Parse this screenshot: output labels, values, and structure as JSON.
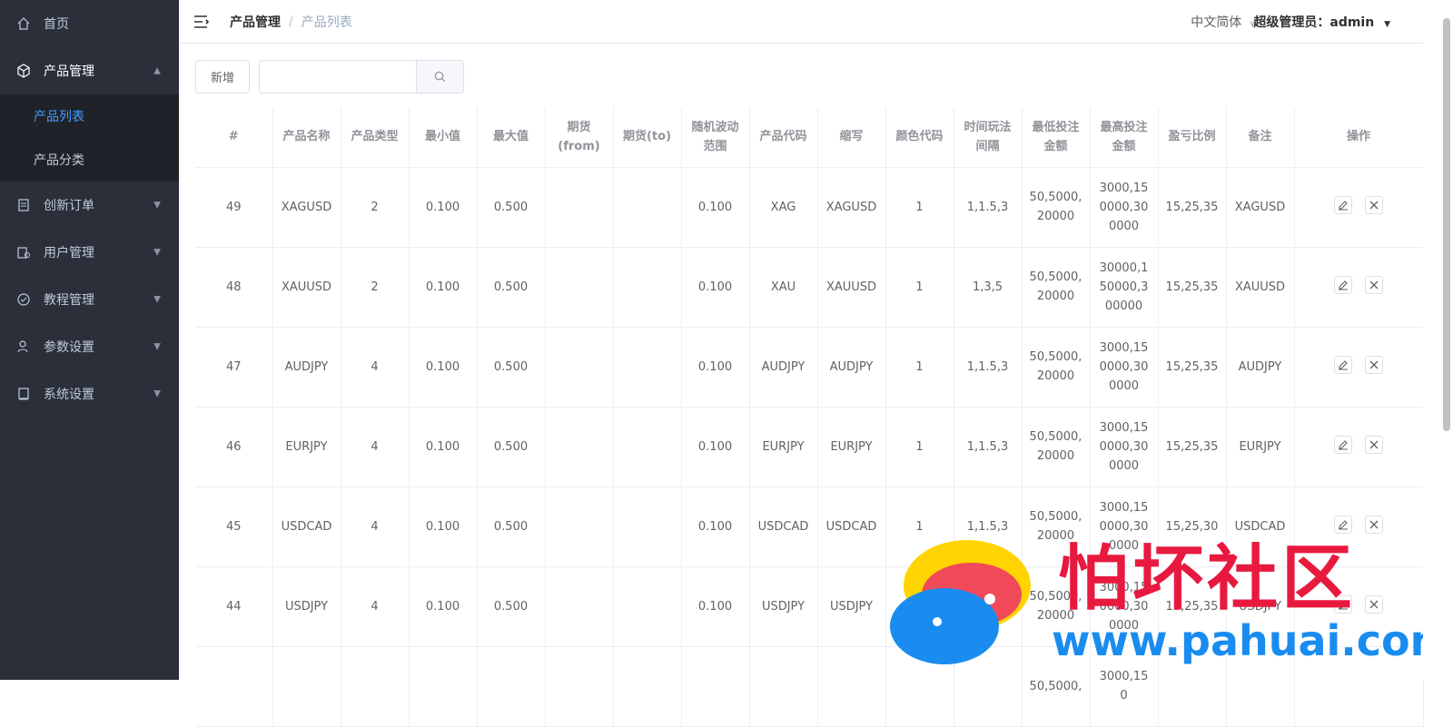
{
  "sidebar": {
    "items": [
      {
        "label": "首页",
        "icon": "home-icon"
      },
      {
        "label": "产品管理",
        "icon": "box-icon",
        "open": true,
        "children": [
          {
            "label": "产品列表",
            "active": true
          },
          {
            "label": "产品分类"
          }
        ]
      },
      {
        "label": "创新订单",
        "icon": "clipboard-icon"
      },
      {
        "label": "用户管理",
        "icon": "users-icon"
      },
      {
        "label": "教程管理",
        "icon": "check-circle-icon"
      },
      {
        "label": "参数设置",
        "icon": "user-settings-icon"
      },
      {
        "label": "系统设置",
        "icon": "book-icon"
      }
    ]
  },
  "header": {
    "breadcrumb": [
      "产品管理",
      "产品列表"
    ],
    "language": "中文简体",
    "user": "超级管理员：admin"
  },
  "toolbar": {
    "add_label": "新增",
    "search_placeholder": ""
  },
  "table": {
    "columns": [
      "#",
      "产品名称",
      "产品类型",
      "最小值",
      "最大值",
      "期货(from)",
      "期货(to)",
      "随机波动范围",
      "产品代码",
      "缩写",
      "颜色代码",
      "时间玩法间隔",
      "最低投注金额",
      "最高投注金额",
      "盈亏比例",
      "备注",
      "操作"
    ],
    "rows": [
      [
        "49",
        "XAGUSD",
        "2",
        "0.100",
        "0.500",
        "",
        "",
        "0.100",
        "XAG",
        "XAGUSD",
        "1",
        "1,1.5,3",
        "50,5000,20000",
        "3000,150000,300000",
        "15,25,35",
        "XAGUSD"
      ],
      [
        "48",
        "XAUUSD",
        "2",
        "0.100",
        "0.500",
        "",
        "",
        "0.100",
        "XAU",
        "XAUUSD",
        "1",
        "1,3,5",
        "50,5000,20000",
        "30000,150000,300000",
        "15,25,35",
        "XAUUSD"
      ],
      [
        "47",
        "AUDJPY",
        "4",
        "0.100",
        "0.500",
        "",
        "",
        "0.100",
        "AUDJPY",
        "AUDJPY",
        "1",
        "1,1.5,3",
        "50,5000,20000",
        "3000,150000,300000",
        "15,25,35",
        "AUDJPY"
      ],
      [
        "46",
        "EURJPY",
        "4",
        "0.100",
        "0.500",
        "",
        "",
        "0.100",
        "EURJPY",
        "EURJPY",
        "1",
        "1,1.5,3",
        "50,5000,20000",
        "3000,150000,300000",
        "15,25,35",
        "EURJPY"
      ],
      [
        "45",
        "USDCAD",
        "4",
        "0.100",
        "0.500",
        "",
        "",
        "0.100",
        "USDCAD",
        "USDCAD",
        "1",
        "1,1.5,3",
        "50,5000,20000",
        "3000,150000,300000",
        "15,25,30",
        "USDCAD"
      ],
      [
        "44",
        "USDJPY",
        "4",
        "0.100",
        "0.500",
        "",
        "",
        "0.100",
        "USDJPY",
        "USDJPY",
        "1",
        "1,1.5,3",
        "50,5000,20000",
        "3000,150000,300000",
        "15,25,35",
        "USDJPY"
      ],
      [
        "",
        "",
        "",
        "",
        "",
        "",
        "",
        "",
        "",
        "",
        "",
        "",
        "50,5000,",
        "3000,150",
        "",
        ""
      ]
    ]
  },
  "watermark": {
    "title": "怕坏社区",
    "url": "www.pahuai.com"
  },
  "colors": {
    "sidebar_bg": "#2b2f3a",
    "active": "#409eff",
    "watermark_red": "#e8193f",
    "watermark_blue": "#1a8cf0"
  }
}
